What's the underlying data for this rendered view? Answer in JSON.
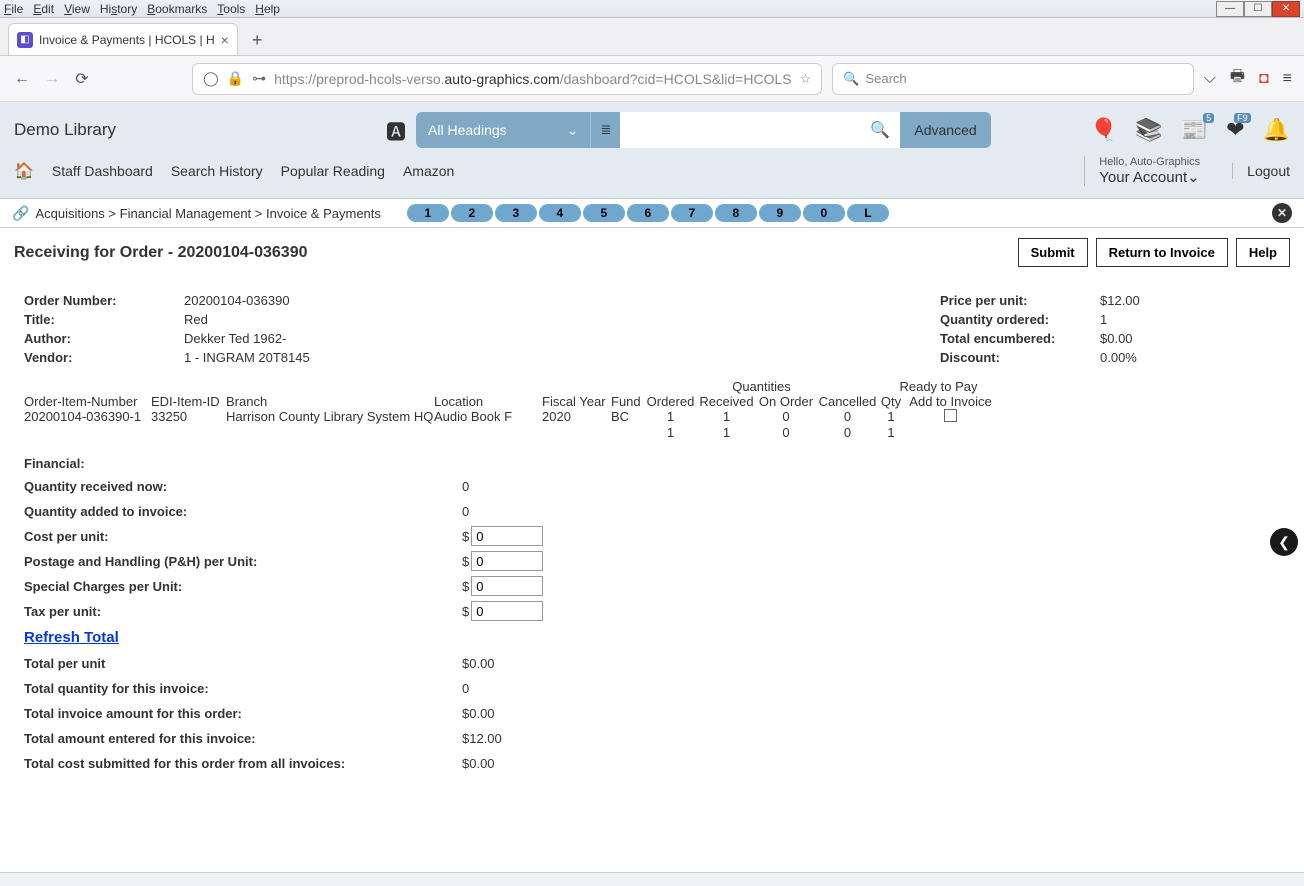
{
  "chrome": {
    "menu": [
      "File",
      "Edit",
      "View",
      "History",
      "Bookmarks",
      "Tools",
      "Help"
    ]
  },
  "tab": {
    "title": "Invoice & Payments | HCOLS | H"
  },
  "url": {
    "prefix": "https://preprod-hcols-verso.",
    "host": "auto-graphics.com",
    "suffix": "/dashboard?cid=HCOLS&lid=HCOLS"
  },
  "browser_search_placeholder": "Search",
  "library": {
    "name": "Demo Library",
    "headings_label": "All Headings",
    "advanced": "Advanced",
    "news_badge": "5",
    "heart_badge": "F9",
    "greeting": "Hello, Auto-Graphics",
    "account_label": "Your Account",
    "logout": "Logout",
    "nav": [
      "Staff Dashboard",
      "Search History",
      "Popular Reading",
      "Amazon"
    ]
  },
  "crumbs": [
    "Acquisitions",
    "Financial Management",
    "Invoice & Payments"
  ],
  "pills": [
    "1",
    "2",
    "3",
    "4",
    "5",
    "6",
    "7",
    "8",
    "9",
    "0",
    "L"
  ],
  "page": {
    "title": "Receiving for Order - 20200104-036390",
    "submit": "Submit",
    "return": "Return to Invoice",
    "help": "Help"
  },
  "order": {
    "left": [
      {
        "label": "Order Number:",
        "value": "20200104-036390"
      },
      {
        "label": "Title:",
        "value": "Red"
      },
      {
        "label": "Author:",
        "value": "Dekker Ted 1962-"
      },
      {
        "label": "Vendor:",
        "value": "1 - INGRAM 20T8145"
      }
    ],
    "right": [
      {
        "label": "Price per unit:",
        "value": "$12.00"
      },
      {
        "label": "Quantity ordered:",
        "value": "1"
      },
      {
        "label": "Total encumbered:",
        "value": "$0.00"
      },
      {
        "label": "Discount:",
        "value": "0.00%"
      }
    ]
  },
  "table": {
    "super_quantities": "Quantities",
    "super_ready": "Ready to Pay",
    "cols": {
      "order": "Order-Item-Number",
      "edi": "EDI-Item-ID",
      "branch": "Branch",
      "loc": "Location",
      "fy": "Fiscal Year",
      "fund": "Fund",
      "ordered": "Ordered",
      "received": "Received",
      "onorder": "On Order",
      "cancelled": "Cancelled",
      "qty": "Qty",
      "addinv": "Add to Invoice"
    },
    "rows": [
      {
        "order": "20200104-036390-1",
        "edi": "33250",
        "branch": "Harrison County Library System HQ",
        "loc": "Audio Book F",
        "fy": "2020",
        "fund": "BC",
        "ordered": "1",
        "received": "1",
        "onorder": "0",
        "cancelled": "0",
        "qty": "1",
        "addinv_checkbox": true
      },
      {
        "order": "",
        "edi": "",
        "branch": "",
        "loc": "",
        "fy": "",
        "fund": "",
        "ordered": "1",
        "received": "1",
        "onorder": "0",
        "cancelled": "0",
        "qty": "1",
        "addinv_checkbox": false
      }
    ]
  },
  "financial": {
    "heading": "Financial:",
    "qty_received_now": {
      "label": "Quantity received now:",
      "value": "0"
    },
    "qty_added_invoice": {
      "label": "Quantity added to invoice:",
      "value": "0"
    },
    "cost_per_unit": {
      "label": "Cost per unit:",
      "prefix": "$",
      "value": "0"
    },
    "ph_per_unit": {
      "label": "Postage and Handling (P&H) per Unit:",
      "prefix": "$",
      "value": "0"
    },
    "special_per_unit": {
      "label": "Special Charges per Unit:",
      "prefix": "$",
      "value": "0"
    },
    "tax_per_unit": {
      "label": "Tax per unit:",
      "prefix": "$",
      "value": "0"
    },
    "refresh": "Refresh Total",
    "total_per_unit": {
      "label": "Total per unit",
      "value": "$0.00"
    },
    "total_qty_invoice": {
      "label": "Total quantity for this invoice:",
      "value": "0"
    },
    "total_invoice_order": {
      "label": "Total invoice amount for this order:",
      "value": "$0.00"
    },
    "total_entered_invoice": {
      "label": "Total amount entered for this invoice:",
      "value": "$12.00"
    },
    "total_submitted_all": {
      "label": "Total cost submitted for this order from all invoices:",
      "value": "$0.00"
    }
  }
}
